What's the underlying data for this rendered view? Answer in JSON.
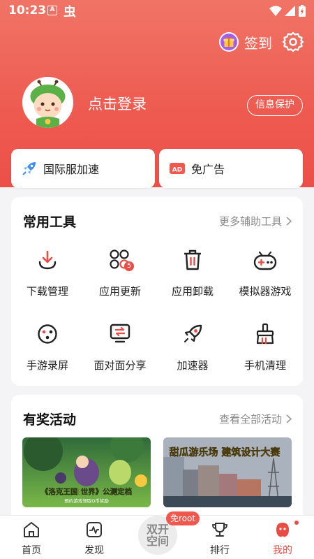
{
  "status_bar": {
    "time": "10:23",
    "notif_letter": "A",
    "notif_char": "虫",
    "icons": [
      "wifi-icon",
      "signal-icon",
      "battery-icon"
    ]
  },
  "header": {
    "checkin_label": "签到",
    "login_prompt": "点击登录",
    "privacy_label": "信息保护"
  },
  "promos": [
    {
      "label": "国际服加速",
      "icon": "rocket-icon"
    },
    {
      "label": "免广告",
      "icon": "ad-icon"
    }
  ],
  "tools": {
    "title": "常用工具",
    "more": "更多辅助工具",
    "items": [
      {
        "label": "下载管理",
        "icon": "download-icon"
      },
      {
        "label": "应用更新",
        "icon": "app-update-icon",
        "badge": "5"
      },
      {
        "label": "应用卸载",
        "icon": "trash-icon"
      },
      {
        "label": "模拟器游戏",
        "icon": "gamepad-icon"
      },
      {
        "label": "手游录屏",
        "icon": "record-icon"
      },
      {
        "label": "面对面分享",
        "icon": "share-icon"
      },
      {
        "label": "加速器",
        "icon": "rocket-icon"
      },
      {
        "label": "手机清理",
        "icon": "broom-icon"
      }
    ]
  },
  "events": {
    "title": "有奖活动",
    "more": "查看全部活动",
    "banners": [
      {
        "text": "《洛克王国:世界》公测定档",
        "subtext": "预约游戏领取Q币奖励"
      },
      {
        "text": "甜瓜游乐场 建筑设计大赛"
      }
    ]
  },
  "nav": {
    "items": [
      {
        "label": "首页",
        "icon": "home-icon"
      },
      {
        "label": "发现",
        "icon": "discover-icon"
      },
      {
        "label": "排行",
        "icon": "trophy-icon"
      },
      {
        "label": "我的",
        "icon": "profile-icon",
        "active": true
      }
    ],
    "center": {
      "line1": "双开",
      "line2": "空间",
      "badge": "免root"
    }
  },
  "colors": {
    "accent": "#e94c43",
    "hero_top": "#f07466",
    "hero_bottom": "#ec5048"
  }
}
